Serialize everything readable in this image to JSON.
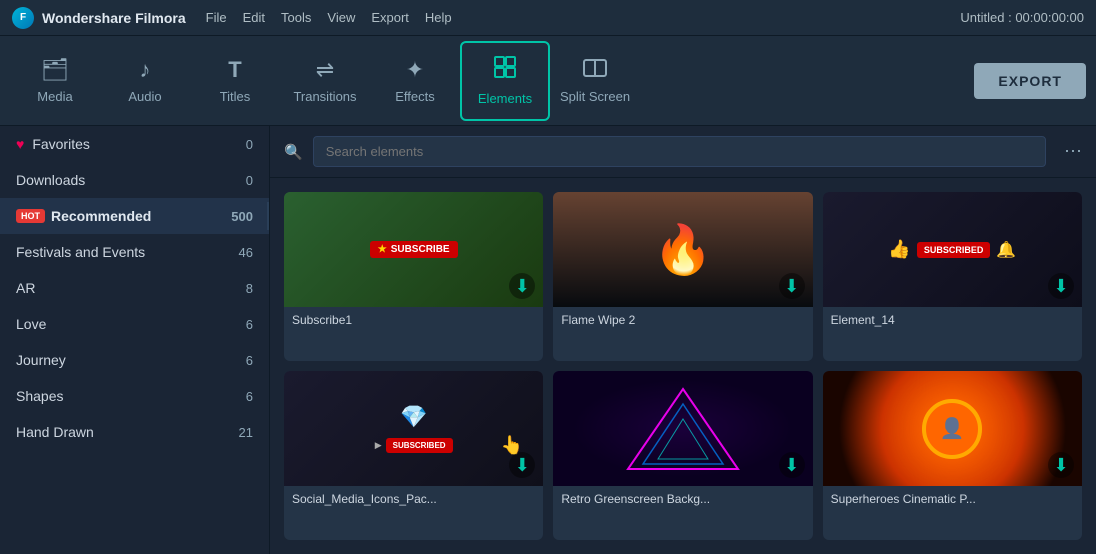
{
  "app": {
    "name": "Wondershare Filmora",
    "title": "Untitled : 00:00:00:00"
  },
  "menu": {
    "items": [
      "File",
      "Edit",
      "Tools",
      "View",
      "Export",
      "Help"
    ]
  },
  "toolbar": {
    "items": [
      {
        "id": "media",
        "label": "Media",
        "icon": "🗂"
      },
      {
        "id": "audio",
        "label": "Audio",
        "icon": "♪"
      },
      {
        "id": "titles",
        "label": "Titles",
        "icon": "T"
      },
      {
        "id": "transitions",
        "label": "Transitions",
        "icon": "⇌"
      },
      {
        "id": "effects",
        "label": "Effects",
        "icon": "✦"
      },
      {
        "id": "elements",
        "label": "Elements",
        "icon": "◻◻"
      },
      {
        "id": "split-screen",
        "label": "Split Screen",
        "icon": "⬛"
      }
    ],
    "active": "elements",
    "export_label": "EXPORT"
  },
  "sidebar": {
    "collapse_icon": "◀",
    "items": [
      {
        "id": "favorites",
        "label": "Favorites",
        "count": "0",
        "icon": "heart"
      },
      {
        "id": "downloads",
        "label": "Downloads",
        "count": "0",
        "icon": null
      },
      {
        "id": "recommended",
        "label": "Recommended",
        "count": "500",
        "hot": true
      },
      {
        "id": "festivals",
        "label": "Festivals and Events",
        "count": "46"
      },
      {
        "id": "ar",
        "label": "AR",
        "count": "8"
      },
      {
        "id": "love",
        "label": "Love",
        "count": "6"
      },
      {
        "id": "journey",
        "label": "Journey",
        "count": "6"
      },
      {
        "id": "shapes",
        "label": "Shapes",
        "count": "6"
      },
      {
        "id": "hand-drawn",
        "label": "Hand Drawn",
        "count": "21"
      }
    ]
  },
  "search": {
    "placeholder": "Search elements"
  },
  "elements": {
    "items": [
      {
        "id": "subscribe1",
        "label": "Subscribe1",
        "type": "subscribe"
      },
      {
        "id": "flame-wipe-2",
        "label": "Flame Wipe 2",
        "type": "flame"
      },
      {
        "id": "element14",
        "label": "Element_14",
        "type": "subscribed"
      },
      {
        "id": "social-media",
        "label": "Social_Media_Icons_Pac...",
        "type": "social"
      },
      {
        "id": "retro-greenscreen",
        "label": "Retro Greenscreen Backg...",
        "type": "neon"
      },
      {
        "id": "superheroes",
        "label": "Superheroes Cinematic P...",
        "type": "hero"
      }
    ]
  }
}
